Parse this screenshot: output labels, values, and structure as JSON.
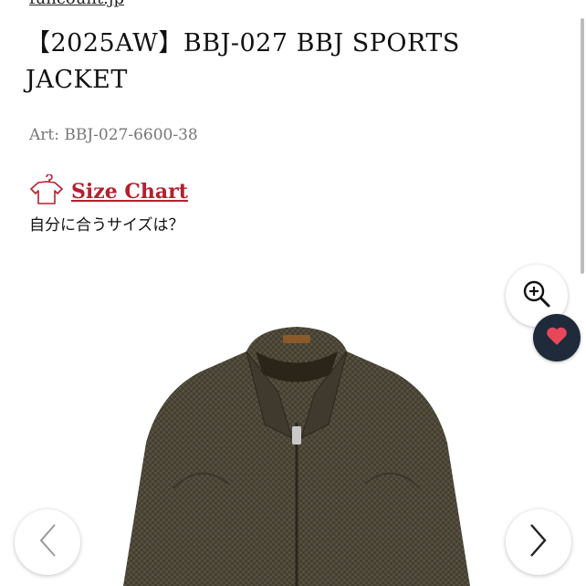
{
  "breadcrumb": "funcount.jp",
  "product": {
    "title": "【2025AW】BBJ-027 BBJ SPORTS JACKET",
    "art_number": "Art: BBJ-027-6600-38"
  },
  "size": {
    "link_label": "Size Chart",
    "question": "自分に合うサイズは？"
  },
  "icons": {
    "hanger": "shirt-hanger-icon",
    "zoom": "zoom-in-icon",
    "favorite": "heart-icon",
    "prev": "chevron-left-icon",
    "next": "chevron-right-icon"
  },
  "colors": {
    "accent": "#b5202e",
    "favorite_bg": "#1f2a3a",
    "heart": "#e8475a"
  }
}
